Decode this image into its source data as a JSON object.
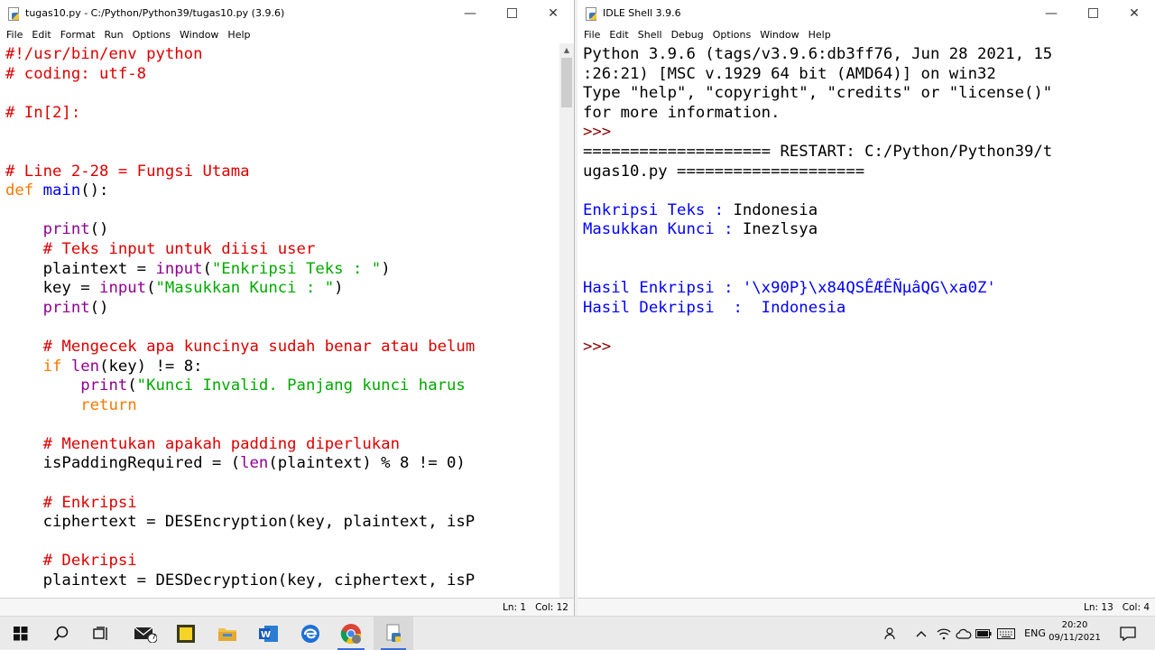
{
  "editor": {
    "title": "tugas10.py - C:/Python/Python39/tugas10.py (3.9.6)",
    "menu": [
      "File",
      "Edit",
      "Format",
      "Run",
      "Options",
      "Window",
      "Help"
    ],
    "status_line": "Ln: 1",
    "status_col": "Col: 12",
    "code": [
      "#!/usr/bin/env python",
      "# coding: utf-8",
      "",
      "# In[2]:",
      "",
      "",
      "# Line 2-28 = Fungsi Utama",
      "def main():",
      "",
      "    print()",
      "    # Teks input untuk diisi user",
      "    plaintext = input(\"Enkripsi Teks : \")",
      "    key = input(\"Masukkan Kunci : \")",
      "    print()",
      "",
      "    # Mengecek apa kuncinya sudah benar atau belum",
      "    if len(key) != 8:",
      "        print(\"Kunci Invalid. Panjang kunci harus",
      "        return",
      "",
      "    # Menentukan apakah padding diperlukan",
      "    isPaddingRequired = (len(plaintext) % 8 != 0)",
      "",
      "    # Enkripsi",
      "    ciphertext = DESEncryption(key, plaintext, isP",
      "",
      "    # Dekripsi",
      "    plaintext = DESDecryption(key, ciphertext, isP"
    ]
  },
  "shell": {
    "title": "IDLE Shell 3.9.6",
    "menu": [
      "File",
      "Edit",
      "Shell",
      "Debug",
      "Options",
      "Window",
      "Help"
    ],
    "status_line": "Ln: 13",
    "status_col": "Col: 4",
    "banner": [
      "Python 3.9.6 (tags/v3.9.6:db3ff76, Jun 28 2021, 15",
      ":26:21) [MSC v.1929 64 bit (AMD64)] on win32",
      "Type \"help\", \"copyright\", \"credits\" or \"license()\"",
      "for more information."
    ],
    "prompt": ">>>",
    "restart": [
      "==================== RESTART: C:/Python/Python39/t",
      "ugas10.py ===================="
    ],
    "enc_label": "Enkripsi Teks : ",
    "enc_value": "Indonesia",
    "key_label": "Masukkan Kunci : ",
    "key_value": "Inezlsya",
    "result_enc": "Hasil Enkripsi : '\\x90P}\\x84QSÊÆÊÑµâQG\\xa0Z'",
    "result_dec": "Hasil Dekripsi  :  Indonesia",
    "final_prompt": ">>>"
  },
  "taskbar": {
    "mail_badge": "7",
    "tray_lang": "ENG",
    "time": "20:20",
    "date": "09/11/2021"
  }
}
